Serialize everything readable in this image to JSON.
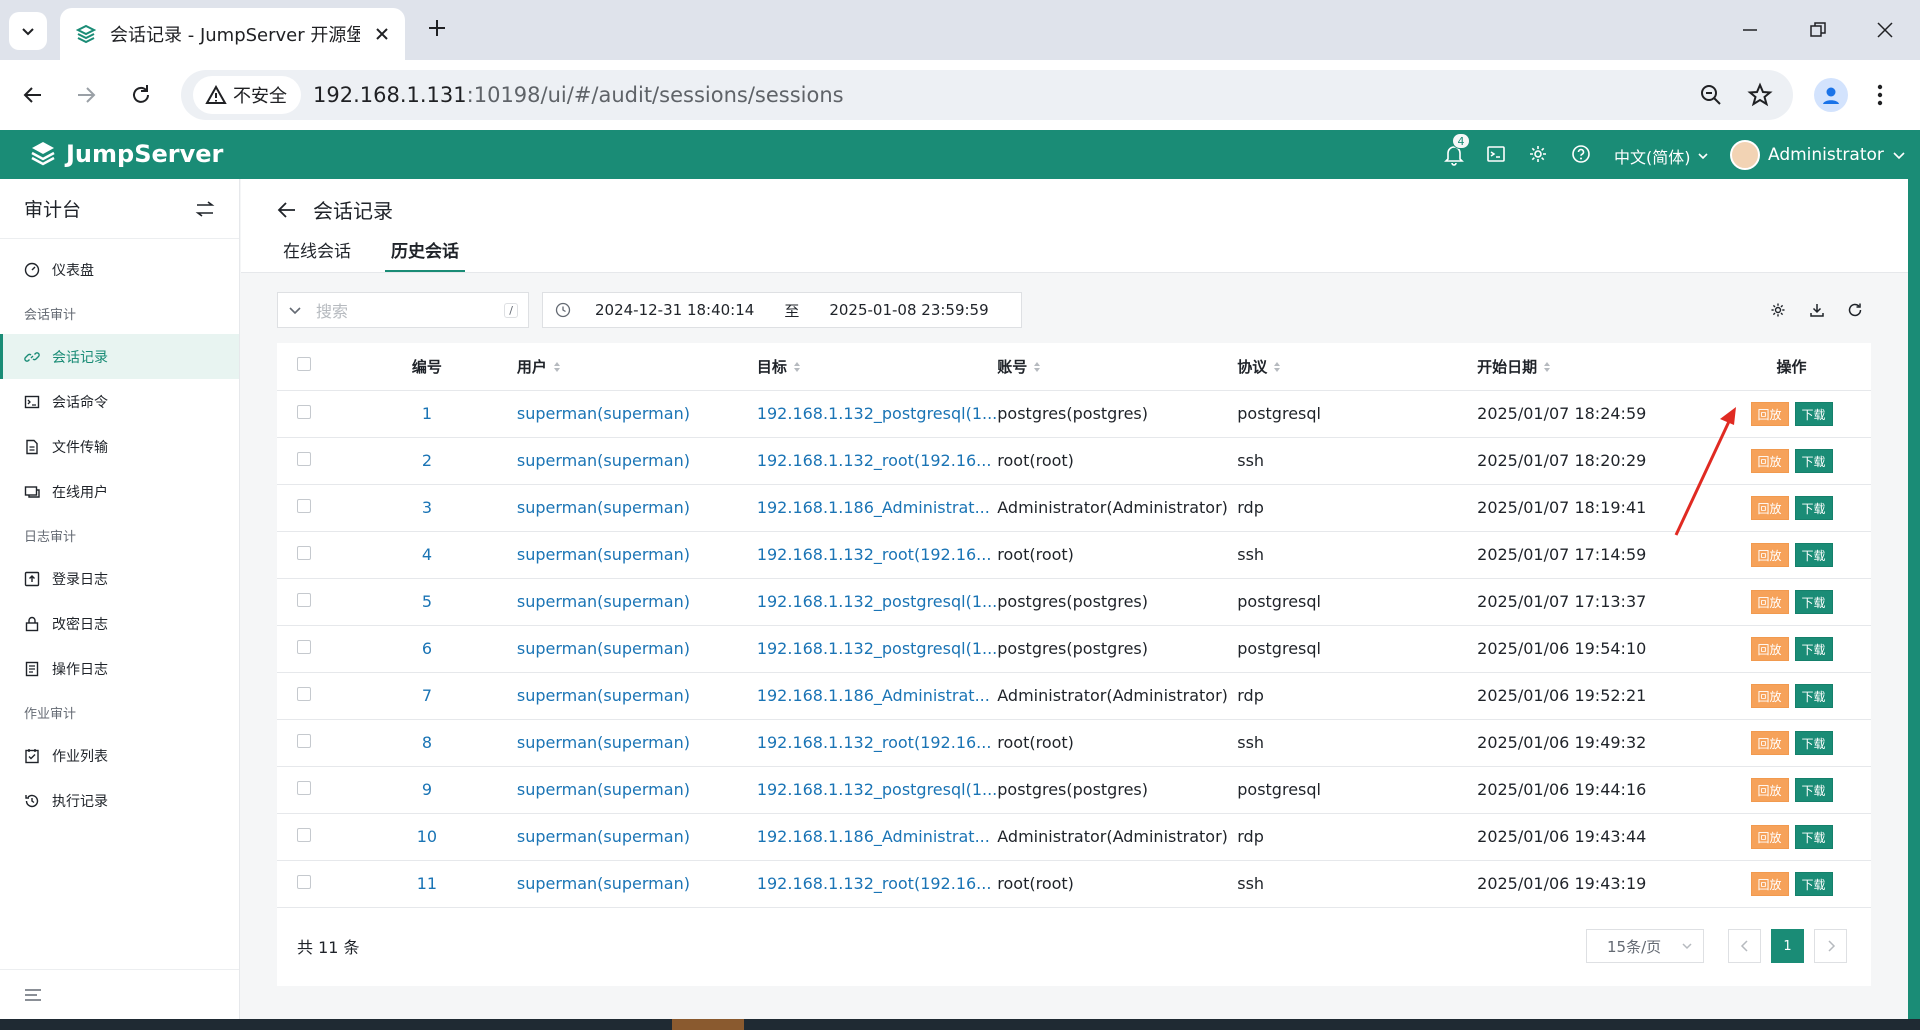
{
  "browser": {
    "tab_title": "会话记录 - JumpServer 开源堡垒机",
    "insecure_label": "不安全",
    "url_host": "192.168.1.131",
    "url_rest": ":10198/ui/#/audit/sessions/sessions"
  },
  "header": {
    "brand": "JumpServer",
    "notification_count": "4",
    "language": "中文(简体)",
    "username": "Administrator",
    "accent_color": "#1a8c76"
  },
  "sidebar": {
    "title": "审计台",
    "groups": [
      {
        "label": "",
        "items": [
          {
            "label": "仪表盘",
            "icon": "dashboard-icon"
          }
        ]
      },
      {
        "label": "会话审计",
        "items": [
          {
            "label": "会话记录",
            "icon": "link-icon",
            "active": true
          },
          {
            "label": "会话命令",
            "icon": "terminal-icon"
          },
          {
            "label": "文件传输",
            "icon": "file-transfer-icon"
          },
          {
            "label": "在线用户",
            "icon": "online-user-icon"
          }
        ]
      },
      {
        "label": "日志审计",
        "items": [
          {
            "label": "登录日志",
            "icon": "login-log-icon"
          },
          {
            "label": "改密日志",
            "icon": "lock-icon"
          },
          {
            "label": "操作日志",
            "icon": "operation-log-icon"
          }
        ]
      },
      {
        "label": "作业审计",
        "items": [
          {
            "label": "作业列表",
            "icon": "job-list-icon"
          },
          {
            "label": "执行记录",
            "icon": "history-icon"
          }
        ]
      }
    ]
  },
  "page": {
    "title": "会话记录",
    "tabs": [
      {
        "label": "在线会话",
        "active": false
      },
      {
        "label": "历史会话",
        "active": true
      }
    ]
  },
  "toolbar": {
    "search_placeholder": "搜索",
    "search_shortcut": "/",
    "date_from": "2024-12-31 18:40:14",
    "date_sep": "至",
    "date_to": "2025-01-08 23:59:59"
  },
  "table": {
    "columns": [
      "编号",
      "用户",
      "目标",
      "账号",
      "协议",
      "开始日期",
      "操作"
    ],
    "play_label": "回放",
    "download_label": "下载",
    "rows": [
      {
        "id": "1",
        "user": "superman(superman)",
        "target": "192.168.1.132_postgresql(1...",
        "account": "postgres(postgres)",
        "protocol": "postgresql",
        "date": "2025/01/07 18:24:59"
      },
      {
        "id": "2",
        "user": "superman(superman)",
        "target": "192.168.1.132_root(192.16...",
        "account": "root(root)",
        "protocol": "ssh",
        "date": "2025/01/07 18:20:29"
      },
      {
        "id": "3",
        "user": "superman(superman)",
        "target": "192.168.1.186_Administrat...",
        "account": "Administrator(Administrator)",
        "protocol": "rdp",
        "date": "2025/01/07 18:19:41"
      },
      {
        "id": "4",
        "user": "superman(superman)",
        "target": "192.168.1.132_root(192.16...",
        "account": "root(root)",
        "protocol": "ssh",
        "date": "2025/01/07 17:14:59"
      },
      {
        "id": "5",
        "user": "superman(superman)",
        "target": "192.168.1.132_postgresql(1...",
        "account": "postgres(postgres)",
        "protocol": "postgresql",
        "date": "2025/01/07 17:13:37"
      },
      {
        "id": "6",
        "user": "superman(superman)",
        "target": "192.168.1.132_postgresql(1...",
        "account": "postgres(postgres)",
        "protocol": "postgresql",
        "date": "2025/01/06 19:54:10"
      },
      {
        "id": "7",
        "user": "superman(superman)",
        "target": "192.168.1.186_Administrat...",
        "account": "Administrator(Administrator)",
        "protocol": "rdp",
        "date": "2025/01/06 19:52:21"
      },
      {
        "id": "8",
        "user": "superman(superman)",
        "target": "192.168.1.132_root(192.16...",
        "account": "root(root)",
        "protocol": "ssh",
        "date": "2025/01/06 19:49:32"
      },
      {
        "id": "9",
        "user": "superman(superman)",
        "target": "192.168.1.132_postgresql(1...",
        "account": "postgres(postgres)",
        "protocol": "postgresql",
        "date": "2025/01/06 19:44:16"
      },
      {
        "id": "10",
        "user": "superman(superman)",
        "target": "192.168.1.186_Administrat...",
        "account": "Administrator(Administrator)",
        "protocol": "rdp",
        "date": "2025/01/06 19:43:44"
      },
      {
        "id": "11",
        "user": "superman(superman)",
        "target": "192.168.1.132_root(192.16...",
        "account": "root(root)",
        "protocol": "ssh",
        "date": "2025/01/06 19:43:19"
      }
    ]
  },
  "pagination": {
    "total": "共 11 条",
    "page_size": "15条/页",
    "current_page": "1"
  }
}
